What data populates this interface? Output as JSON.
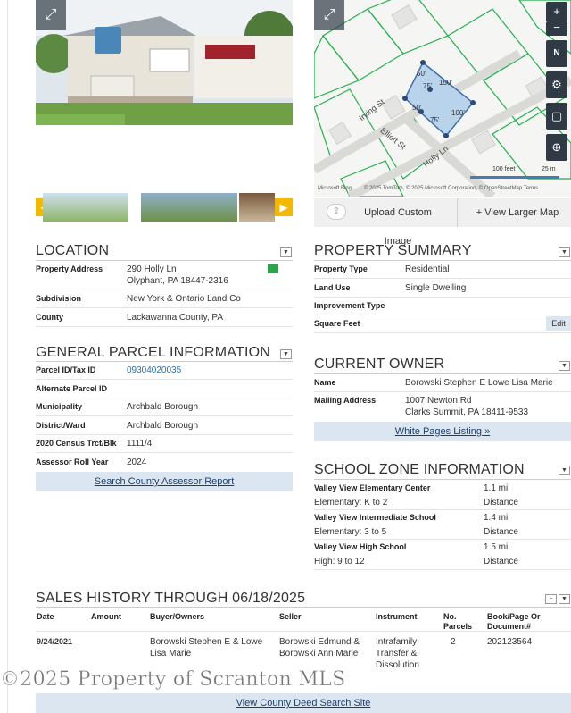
{
  "map": {
    "streets": [
      "Irving St",
      "Elliott St",
      "Holly Ln"
    ],
    "parcel_dims": [
      "50'",
      "150'",
      "75'",
      "50'",
      "75'",
      "100'"
    ],
    "scale_feet": "100 feet",
    "scale_m": "25 m",
    "attribution_brand": "Microsoft Bing",
    "attribution": "© 2025 TomTom, © 2025 Microsoft Corporation, © OpenStreetMap  Terms",
    "upload_label": "Upload Custom Image",
    "larger_label": "+ View Larger Map",
    "zoom_in": "+",
    "zoom_out": "−",
    "north": "N"
  },
  "location": {
    "title": "LOCATION",
    "rows": [
      {
        "label": "Property Address",
        "value": "290 Holly Ln",
        "value2": "Olyphant, PA 18447-2316"
      },
      {
        "label": "Subdivision",
        "value": "New York & Ontario Land Co"
      },
      {
        "label": "County",
        "value": "Lackawanna County, PA"
      }
    ]
  },
  "parcel": {
    "title": "GENERAL PARCEL INFORMATION",
    "rows": [
      {
        "label": "Parcel ID/Tax ID",
        "value": "09304020035"
      },
      {
        "label": "Alternate Parcel ID",
        "value": ""
      },
      {
        "label": "Municipality",
        "value": "Archbald Borough"
      },
      {
        "label": "District/Ward",
        "value": "Archbald Borough"
      },
      {
        "label": "2020 Census Trct/Blk",
        "value": "1111/4"
      },
      {
        "label": "Assessor Roll Year",
        "value": "2024"
      }
    ],
    "button": "Search County Assessor Report"
  },
  "summary": {
    "title": "PROPERTY SUMMARY",
    "rows": [
      {
        "label": "Property Type",
        "value": "Residential"
      },
      {
        "label": "Land Use",
        "value": "Single Dwelling"
      },
      {
        "label": "Improvement Type",
        "value": ""
      },
      {
        "label": "Square Feet",
        "value": ""
      }
    ],
    "edit": "Edit"
  },
  "owner": {
    "title": "CURRENT OWNER",
    "rows": [
      {
        "label": "Name",
        "value": "Borowski Stephen E Lowe Lisa Marie"
      },
      {
        "label": "Mailing Address",
        "value": "1007 Newton Rd",
        "value2": "Clarks Summit, PA 18411-9533"
      }
    ],
    "button": "White Pages Listing »"
  },
  "school": {
    "title": "SCHOOL ZONE INFORMATION",
    "rows": [
      {
        "name": "Valley View Elementary Center",
        "dist": "1.1 mi",
        "grades": "Elementary: K to 2",
        "dist_label": "Distance"
      },
      {
        "name": "Valley View Intermediate School",
        "dist": "1.4 mi",
        "grades": "Elementary: 3 to 5",
        "dist_label": "Distance"
      },
      {
        "name": "Valley View High School",
        "dist": "1.5 mi",
        "grades": "High: 9 to 12",
        "dist_label": "Distance"
      }
    ]
  },
  "sales": {
    "title": "SALES HISTORY THROUGH 06/18/2025",
    "headers": [
      "Date",
      "Amount",
      "Buyer/Owners",
      "Seller",
      "Instrument",
      "No. Parcels",
      "Book/Page Or Document#"
    ],
    "rows": [
      {
        "date": "9/24/2021",
        "amount": "",
        "buyer": "Borowski Stephen E & Lowe Lisa Marie",
        "seller": "Borowski Edmund & Borowski Ann Marie",
        "instrument": "Intrafamily Transfer & Dissolution",
        "parcels": "2",
        "doc": "202123564"
      }
    ],
    "button": "View County Deed Search Site"
  },
  "watermark": "©2025 Property of Scranton MLS"
}
